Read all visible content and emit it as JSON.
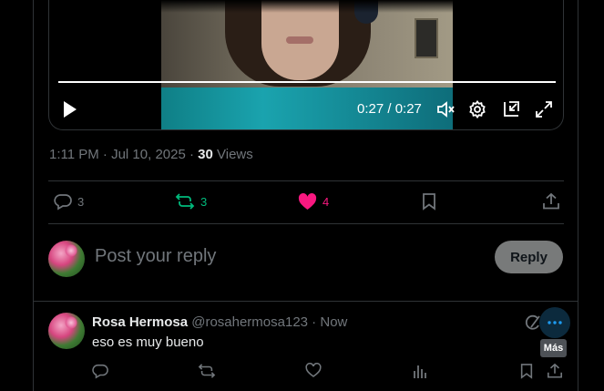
{
  "video": {
    "time": "0:27 / 0:27",
    "progress_fraction": 1.0
  },
  "post": {
    "time": "1:11 PM · Jul 10, 2025",
    "separator": " · ",
    "views_count": "30",
    "views_label": "Views"
  },
  "actions": {
    "replies": "3",
    "reposts": "3",
    "likes": "4"
  },
  "composer": {
    "placeholder": "Post your reply",
    "reply_label": "Reply"
  },
  "reply": {
    "name": "Rosa Hermosa",
    "handle": "@rosahermosa123",
    "dot": " · ",
    "time": "Now",
    "text": "eso es muy bueno",
    "more_tooltip": "Más"
  },
  "colors": {
    "repost": "#00ba7c",
    "like": "#f91880",
    "muted": "#71767b"
  }
}
